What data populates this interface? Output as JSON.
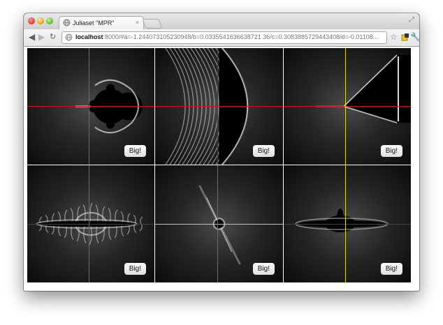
{
  "window": {
    "tab_title": "Juliaset \"MPR\"",
    "tab_close": "×",
    "url_host": "localhost",
    "url_rest": ":8000/#a=-1.244073105230948/b=0.0335541636638721 36/c=0.3083885729443408/d=-0.01108...",
    "icons": [
      "globe-icon",
      "back-icon",
      "forward-icon",
      "reload-icon",
      "star-icon",
      "extension-icon",
      "wrench-icon",
      "resize-icon"
    ],
    "traffic_colors": {
      "close": "#e0443e",
      "minimize": "#e5a82a",
      "zoom": "#6cc03a"
    }
  },
  "panels": [
    {
      "name": "panel-mandelbrot",
      "button": "Big!",
      "h_line": "red",
      "v_line": "green"
    },
    {
      "name": "panel-ab",
      "button": "Big!",
      "h_line": "red",
      "v_line": "blue"
    },
    {
      "name": "panel-ac",
      "button": "Big!",
      "h_line": "red",
      "v_line": "yellow"
    },
    {
      "name": "panel-julia-bd",
      "button": "Big!",
      "h_line": "blue",
      "v_line": "green"
    },
    {
      "name": "panel-cd",
      "button": "Big!",
      "h_line": "yellow",
      "v_line": "green"
    },
    {
      "name": "panel-julia",
      "button": "Big!",
      "h_line": "blue",
      "v_line": "yellow"
    }
  ],
  "line_colors": {
    "red": "#d0101a",
    "green": "#1ea02a",
    "blue": "#2536c8",
    "yellow": "#e0d21a"
  }
}
